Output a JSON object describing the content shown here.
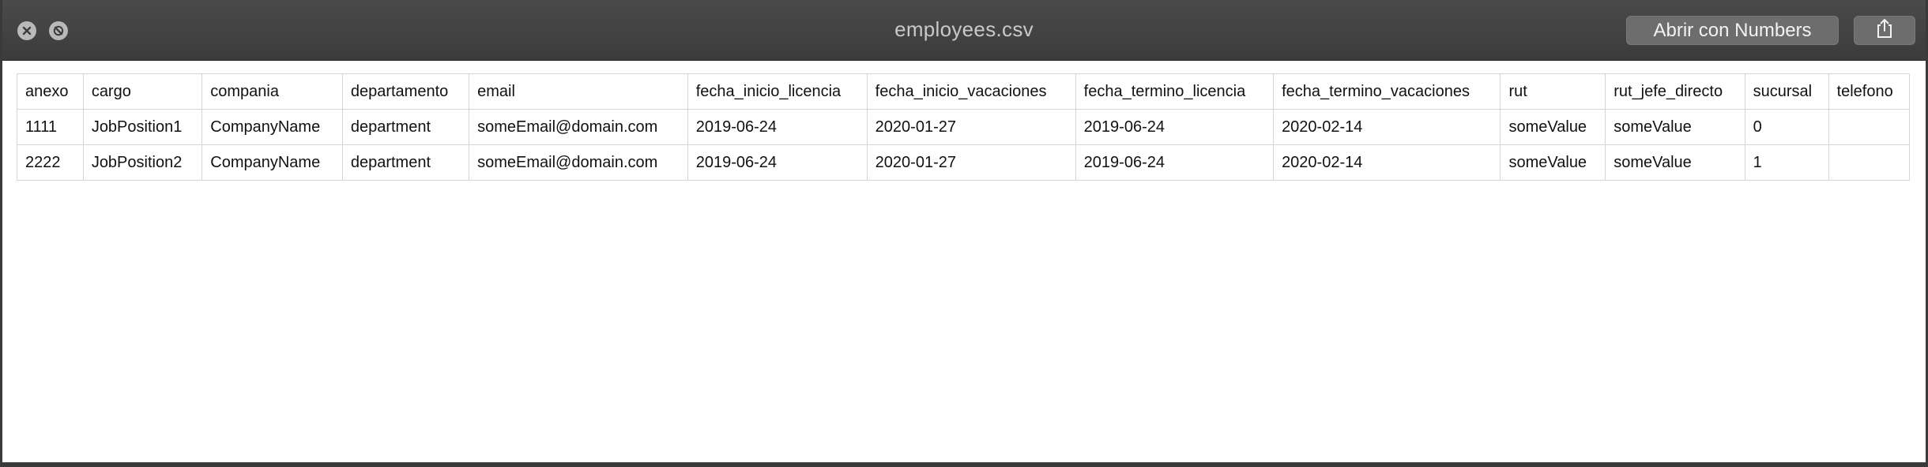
{
  "window": {
    "title": "employees.csv",
    "open_button_label": "Abrir con Numbers"
  },
  "icons": {
    "close": "close-icon",
    "fullscreen": "fullscreen-icon",
    "share": "share-icon"
  },
  "table": {
    "headers": [
      "anexo",
      "cargo",
      "compania",
      "departamento",
      "email",
      "fecha_inicio_licencia",
      "fecha_inicio_vacaciones",
      "fecha_termino_licencia",
      "fecha_termino_vacaciones",
      "rut",
      "rut_jefe_directo",
      "sucursal",
      "telefono"
    ],
    "rows": [
      [
        "1111",
        "JobPosition1",
        "CompanyName",
        "department",
        "someEmail@domain.com",
        "2019-06-24",
        "2020-01-27",
        "2019-06-24",
        "2020-02-14",
        "someValue",
        "someValue",
        "0",
        ""
      ],
      [
        "2222",
        "JobPosition2",
        "CompanyName",
        "department",
        "someEmail@domain.com",
        "2019-06-24",
        "2020-01-27",
        "2019-06-24",
        "2020-02-14",
        "someValue",
        "someValue",
        "1",
        ""
      ]
    ]
  }
}
